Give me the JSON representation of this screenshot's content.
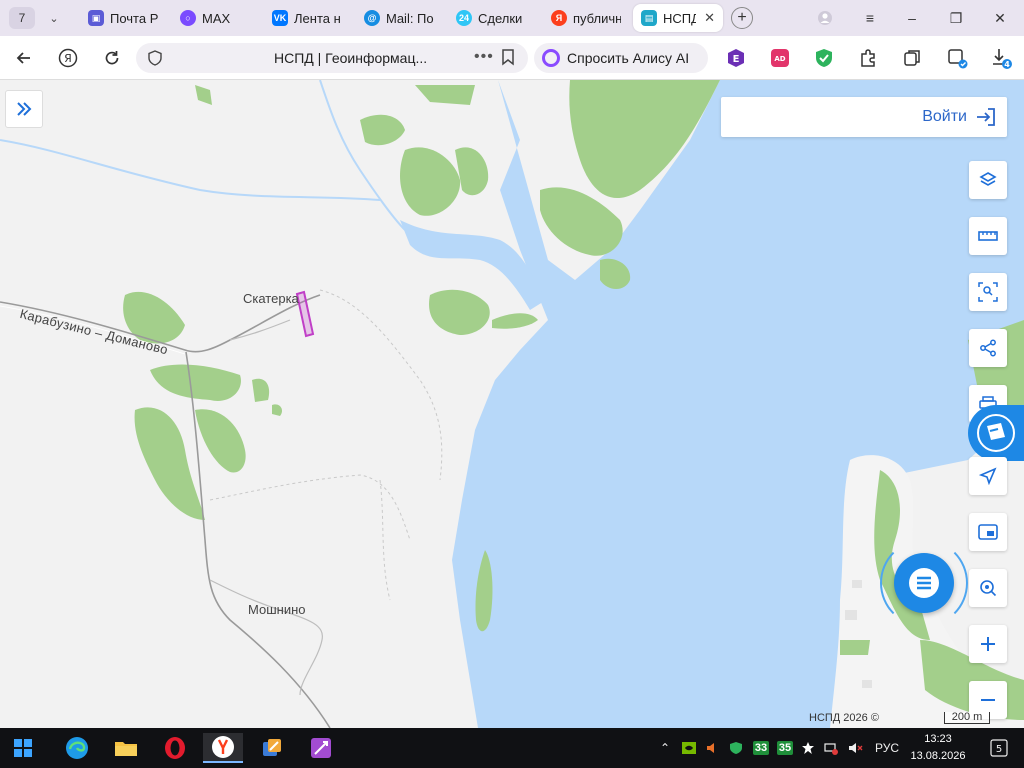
{
  "tabs": {
    "count_label": "7",
    "items": [
      {
        "label": "Почта Р",
        "icon": "mail-cube-icon",
        "color": "#5b5bd6"
      },
      {
        "label": "MAX",
        "icon": "max-messenger-icon",
        "color": "#7a4bff"
      },
      {
        "label": "Лента н",
        "icon": "vk-icon",
        "color": "#0077ff"
      },
      {
        "label": "Mail: По",
        "icon": "mail-at-icon",
        "color": "#168de2"
      },
      {
        "label": "Сделки",
        "icon": "bitrix24-icon",
        "color": "#2fc6f6"
      },
      {
        "label": "публичн",
        "icon": "yandex-icon",
        "color": "#fc3f1d"
      },
      {
        "label": "НСПД",
        "icon": "nspd-icon",
        "color": "#1fa7c9"
      }
    ]
  },
  "toolbar": {
    "page_title": "НСПД | Геоинформац...",
    "alice_label": "Спросить Алису AI",
    "download_count": "4"
  },
  "map": {
    "login_label": "Войти",
    "places": {
      "skaterka": "Скатерка",
      "moshnino": "Мошнино",
      "road": "Карабузино – Доманово"
    },
    "copyright": "НСПД 2026 ©",
    "scale_label": "200 m",
    "colors": {
      "water": "#b7d8f9",
      "forest": "#a3cf8b",
      "land": "#f2f2f2",
      "accent": "#1e88e5",
      "parcel": "#c03fc7"
    }
  },
  "taskbar": {
    "tray": {
      "lang": "РУС",
      "badge_a": "33",
      "badge_b": "35",
      "notifications": "5"
    },
    "time": "13:23",
    "date": "13.08.2026"
  }
}
